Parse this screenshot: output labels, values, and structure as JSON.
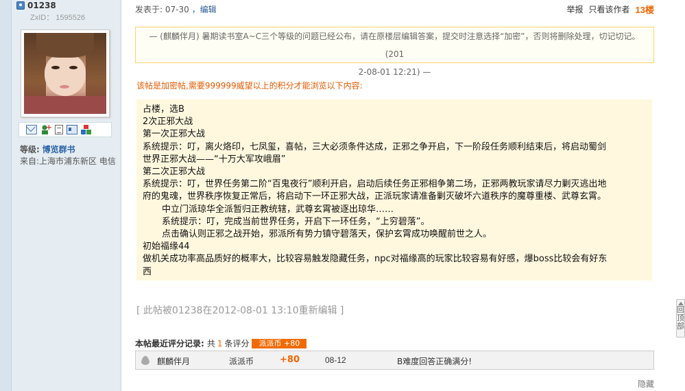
{
  "user": {
    "name": "01238",
    "zxid": "ZxID： 1595526",
    "level_label": "等级:",
    "level_value": "博览群书",
    "from": "来自:上海市浦东新区 电信"
  },
  "post": {
    "posted_prefix": "发表于: 07-30",
    "edit_label": "，编辑",
    "report": "举报",
    "author_only": "只看该作者",
    "floor": "13楼"
  },
  "notice": {
    "line1": "— (麒麟伴月) 暑期读书室A~C三个等级的问题已经公布，请在原楼层编辑答案，提交时注意选择“加密”，否则将删除处理，切记切记。 (201",
    "line2": "2-08-01 12:21) —"
  },
  "locked_notice": "该帖是加密帖,需要999999威望以上的积分才能浏览以下内容:",
  "content": {
    "l1": "占楼，选B",
    "l2": "2次正邪大战",
    "l3": "第一次正邪大战",
    "l4": "系统提示：叮，离火烙印，七凤玺，喜帖，三大必须条件达成，正邪之争开启，下一阶段任务顺利结束后，将启动蜀剑",
    "l5": "世界正邪大战——“十万大军攻峨眉”",
    "l6": "第二次正邪大战",
    "l7": "系统提示：叮，世界任务第二阶“百鬼夜行”顺利开启，启动后续任务正邪相争第二场，正邪两教玩家请尽力剿灭逃出地",
    "l8": "府的鬼魂，世界秩序恢复正常后，将启动下一环正邪大战，正派玩家请准备剿灭破坏六道秩序的魔尊重楼、武尊玄霄。",
    "l9": "中立门派琼华全派暂归正教统辖，武尊玄霄被逐出琼华……",
    "l10": "系统提示：叮，完成当前世界任务，开启下一环任务，“上穷碧落”。",
    "l11": "点击确认则正邪之战开始，邪派所有势力镇守碧落天，保护玄霄成功唤醒前世之人。",
    "l12": "初始福缘44",
    "l13": "做机关成功率高品质好的概率大，比较容易触发隐藏任务，npc对福缘高的玩家比较容易有好感，爆boss比较会有好东",
    "l14": "西"
  },
  "reedit": "[ 此帖被01238在2012-08-01 13:10重新编辑 ]",
  "rating": {
    "title": "本帖最近评分记录:",
    "total_prefix": "共",
    "total_count": "1",
    "total_suffix": "条评分",
    "tag": "派派币 +80",
    "row": {
      "user": "麒麟伴月",
      "item": "派派币",
      "score": "+80",
      "date": "08-12",
      "reason": "B难度回答正确满分!"
    }
  },
  "hide_label": "隐藏",
  "back_top_label": "回顶部",
  "back_top_chars": [
    "回",
    "顶",
    "部"
  ]
}
